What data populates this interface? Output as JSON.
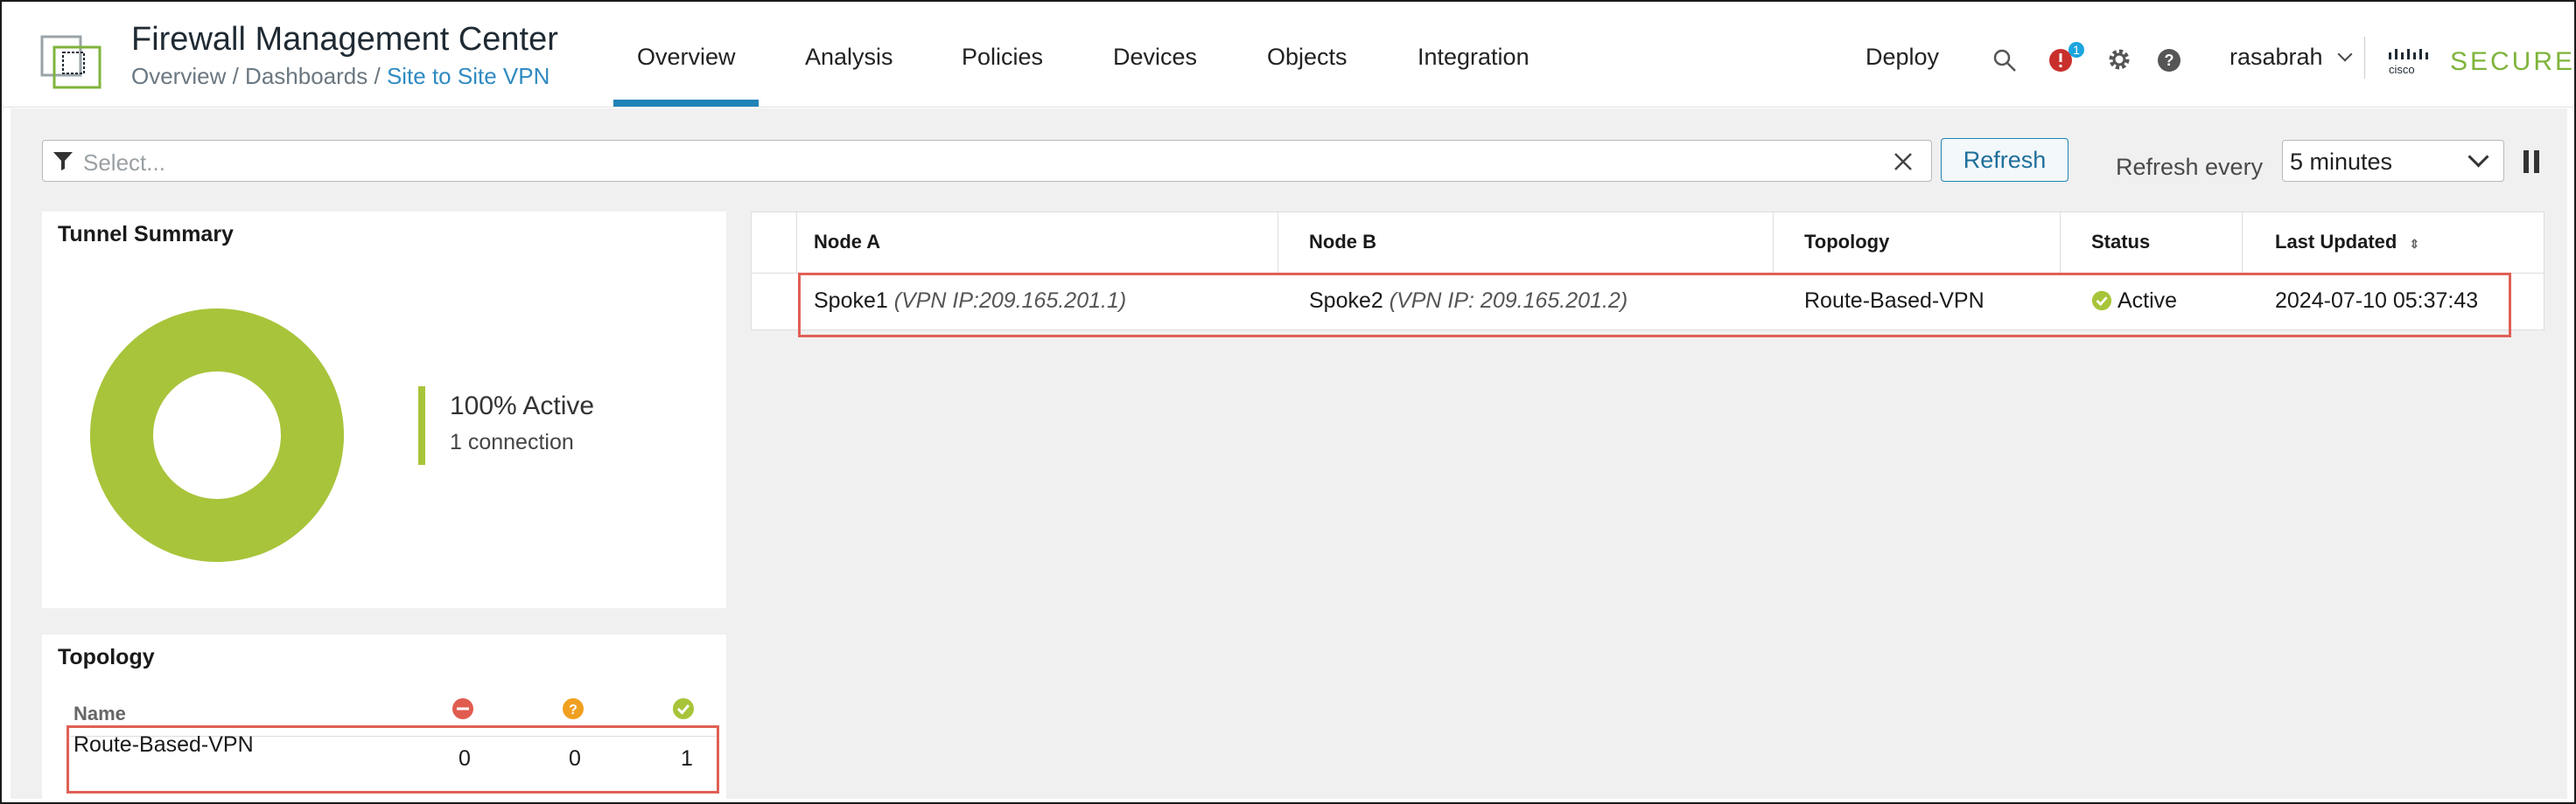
{
  "app": {
    "title": "Firewall Management Center",
    "breadcrumb": [
      "Overview",
      "Dashboards",
      "Site to Site VPN"
    ],
    "nav": [
      "Overview",
      "Analysis",
      "Policies",
      "Devices",
      "Objects",
      "Integration"
    ],
    "active_tab": "Overview",
    "deploy_label": "Deploy",
    "alert_count": "1",
    "user": "rasabrah",
    "brand": "SECURE",
    "brand_small": "cisco"
  },
  "toolbar": {
    "filter_placeholder": "Select...",
    "refresh_label": "Refresh",
    "refresh_every_label": "Refresh every",
    "interval": "5 minutes"
  },
  "tunnel_summary": {
    "title": "Tunnel Summary",
    "active_pct": "100% Active",
    "connections": "1 connection",
    "active_fraction": 1.0
  },
  "topology": {
    "title": "Topology",
    "col_name": "Name",
    "rows": [
      {
        "name": "Route-Based-VPN",
        "down": "0",
        "unknown": "0",
        "up": "1"
      }
    ]
  },
  "table": {
    "columns": [
      "Node A",
      "Node B",
      "Topology",
      "Status",
      "Last Updated"
    ],
    "rows": [
      {
        "node_a": "Spoke1",
        "node_a_ip": "(VPN IP:209.165.201.1)",
        "node_b": "Spoke2",
        "node_b_ip": "(VPN IP: 209.165.201.2)",
        "topology": "Route-Based-VPN",
        "status": "Active",
        "last_updated": "2024-07-10 05:37:43"
      }
    ]
  },
  "colors": {
    "accent": "#1f83b6",
    "active": "#a8c43a",
    "down": "#e05c4f",
    "unknown": "#f0a020",
    "highlight": "#e06055"
  }
}
